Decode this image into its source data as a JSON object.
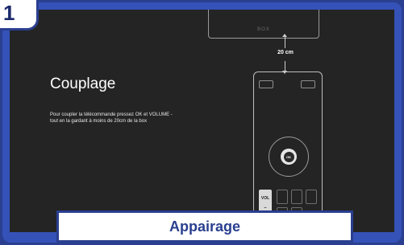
{
  "step": {
    "number": "1"
  },
  "screen": {
    "box_label": "BOX",
    "distance_label": "20 cm",
    "title": "Couplage",
    "description_line1": "Pour coupler la télécommande pressez OK et VOLUME -",
    "description_line2": "tout en la gardant à moins de 20cm de la box"
  },
  "remote": {
    "ok_label": "OK",
    "vol_label": "VOL",
    "vol_minus": "–"
  },
  "caption": {
    "label": "Appairage"
  },
  "colors": {
    "frame_blue": "#2a3f8f",
    "screen_bg": "#242424",
    "caption_text": "#2a3f8f"
  }
}
